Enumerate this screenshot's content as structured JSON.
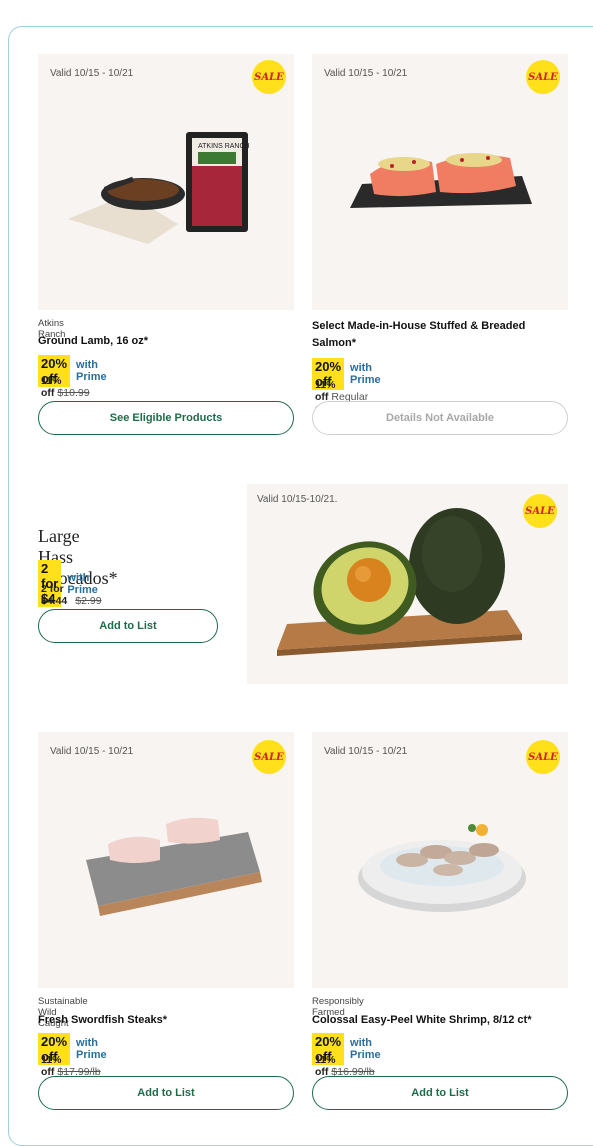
{
  "cards": [
    {
      "valid": "Valid 10/15 - 10/21",
      "sale": "SALE",
      "brand": "Atkins Ranch",
      "title": "Ground Lamb, 16 oz*",
      "promo": "20% off",
      "prime": "with Prime",
      "discount": "11% off",
      "price": "$10.99",
      "button": "See Eligible Products",
      "button_state": "enabled",
      "image": "ground-lamb-package-icon",
      "package_text": "ATKINS RANCH"
    },
    {
      "valid": "Valid 10/15 - 10/21",
      "sale": "SALE",
      "brand": "",
      "title": "Select Made-in-House Stuffed & Breaded Salmon*",
      "promo": "20% off",
      "prime": "with Prime",
      "discount": "11% off",
      "price_note": "Regular prices vary",
      "button": "Details Not Available",
      "button_state": "disabled",
      "image": "salmon-on-slate-icon"
    }
  ],
  "featured": {
    "title": "Large Hass Avocados*",
    "promo": "2 for $4",
    "prime": "with Prime",
    "regular": "2 for $4.44",
    "price": "$2.99",
    "button": "Add to List",
    "valid": "Valid 10/15-10/21.",
    "sale": "SALE",
    "image": "avocados-on-board-icon"
  },
  "cards2": [
    {
      "valid": "Valid 10/15 - 10/21",
      "sale": "SALE",
      "brand": "Sustainable Wild Caught",
      "title": "Fresh Swordfish Steaks*",
      "promo": "20% off",
      "prime": "with Prime",
      "discount": "11% off",
      "price": "$17.99/lb",
      "button": "Add to List",
      "image": "swordfish-on-marble-icon"
    },
    {
      "valid": "Valid 10/15 - 10/21",
      "sale": "SALE",
      "brand": "Responsibly Farmed",
      "title": "Colossal Easy-Peel White Shrimp, 8/12 ct*",
      "promo": "20% off",
      "prime": "with Prime",
      "discount": "11% off",
      "price": "$16.99/lb",
      "button": "Add to List",
      "image": "shrimp-platter-icon"
    }
  ],
  "colors": {
    "sale_badge": "#ffe01b",
    "sale_text": "#d2232a",
    "prime_text": "#2a6f9c",
    "button_border": "#1e6b4a"
  }
}
